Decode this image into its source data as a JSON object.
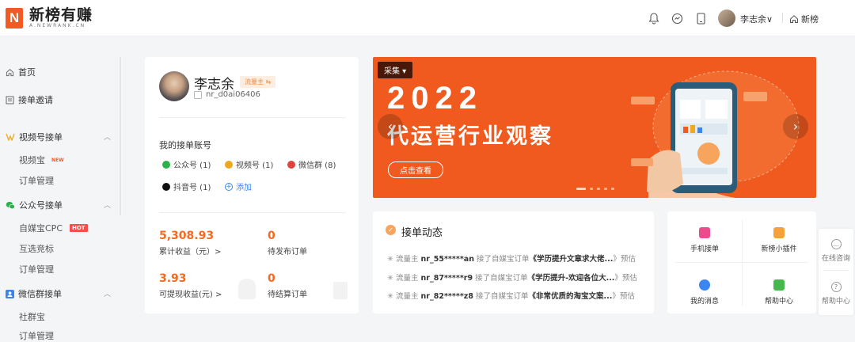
{
  "brand": {
    "name_cn": "新榜有赚",
    "name_en": "A.NEWRANK.CN"
  },
  "header": {
    "icons": [
      "bell-icon",
      "chat-icon",
      "phone-icon"
    ],
    "user_name": "李志余∨",
    "home_link": "新榜"
  },
  "sidebar": {
    "home": "首页",
    "invite": "接单邀请",
    "video_group": "视频号接单",
    "video_items": [
      "视频宝",
      "订单管理"
    ],
    "video_new_badge": "NEW",
    "wechat_group": "公众号接单",
    "wechat_items": [
      "自媒宝CPC",
      "互选竞标",
      "订单管理"
    ],
    "wechat_hot_badge": "HOT",
    "group_group": "微信群接单",
    "group_items": [
      "社群宝",
      "订单管理"
    ]
  },
  "profile": {
    "name": "李志余",
    "role": "流量主 ⇆",
    "id": "nr_d0ai06406",
    "accounts_title": "我的接单账号",
    "accounts": [
      {
        "label": "公众号 (1)",
        "color": "#2bb24c"
      },
      {
        "label": "视频号 (1)",
        "color": "#f0a81a"
      },
      {
        "label": "微信群 (8)",
        "color": "#e0433b"
      },
      {
        "label": "抖音号 (1)",
        "color": "#111111"
      }
    ],
    "add": "添加",
    "stats": [
      {
        "value": "5,308.93",
        "label": "累计收益（元）>"
      },
      {
        "value": "0",
        "label": "待发布订单"
      },
      {
        "value": "3.93",
        "label": "可提现收益(元) >"
      },
      {
        "value": "0",
        "label": "待结算订单"
      }
    ]
  },
  "banner": {
    "tag": "采集 ▾",
    "title": "2022",
    "subtitle": "代运营行业观察",
    "button": "点击查看",
    "slide_count": 5,
    "active_slide": 0
  },
  "feed": {
    "title": "接单动态",
    "items": [
      {
        "role": "流量主",
        "user": "nr_55*****an",
        "action": "接了自媒宝订单",
        "title": "《学历提升文章求大佬...",
        "tail": "》预估"
      },
      {
        "role": "流量主",
        "user": "nr_87*****r9",
        "action": "接了自媒宝订单",
        "title": "《学历提升-欢迎各位大...",
        "tail": "》预估"
      },
      {
        "role": "流量主",
        "user": "nr_82*****z8",
        "action": "接了自媒宝订单",
        "title": "《非常优质的淘宝文案...",
        "tail": "》预估"
      }
    ]
  },
  "quick": [
    {
      "label": "手机接单",
      "color": "#ee4b8c"
    },
    {
      "label": "新榜小插件",
      "color": "#f5a23a"
    },
    {
      "label": "我的消息",
      "color": "#3a86f0"
    },
    {
      "label": "帮助中心",
      "color": "#46b84e"
    }
  ],
  "float": {
    "consult": "在线咨询",
    "help": "帮助中心"
  }
}
